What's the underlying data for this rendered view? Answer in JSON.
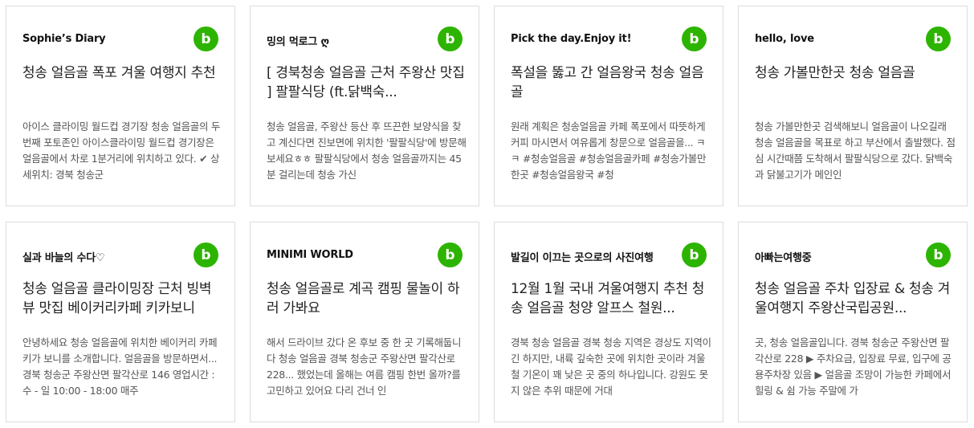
{
  "badge_letter": "b",
  "badge_color": "#2db400",
  "cards": [
    {
      "blog": "Sophie’s Diary",
      "title": "청송 얼음골 폭포 겨울 여행지 추천",
      "desc": "아이스 클라이밍 월드컵 경기장 청송 얼음골의 두 번째 포토존인 아이스클라이밍 월드컵 경기장은 얼음골에서 차로 1분거리에 위치하고 있다. ✔ 상세위치: 경북 청송군"
    },
    {
      "blog": "밍의 먹로그 ღ",
      "title": "[ 경북청송 얼음골 근처 주왕산 맛집 ] 팔팔식당 (ft.닭백숙...",
      "desc": "청송 얼음골, 주왕산 등산 후 뜨끈한 보양식을 찾고 계신다면 진보면에 위치한 '팔팔식당'에 방문해보세요ㅎㅎ 팔팔식당에서 청송 얼음골까지는 45분 걸리는데 청송 가신"
    },
    {
      "blog": "Pick the day.Enjoy it!",
      "title": "폭설을 뚫고 간 얼음왕국 청송 얼음골",
      "desc": "원래 계획은 청송얼음골 카페 폭포에서 따뜻하게 커피 마시면서 여유롭게 창문으로 얼음골을... ㅋㅋ #청송얼음골 #청송얼음골카페 #청송가볼만한곳 #청송얼음왕국 #청"
    },
    {
      "blog": "hello, love",
      "title": "청송 가볼만한곳 청송 얼음골",
      "desc": "청송 가볼만한곳 검색해보니 얼음골이 나오길래 청송 얼음골을 목표로 하고 부산에서 출발했다. 점심 시간때쯤 도착해서 팔팔식당으로 갔다. 닭백숙과 닭불고기가 메인인"
    },
    {
      "blog": "실과 바늘의 수다♡",
      "title": "청송 얼음골 클라이밍장 근처 빙벽뷰 맛집 베이커리카페 키카보니",
      "desc": "안녕하세요 청송 얼음골에 위치한 베이커리 카페 키가 보니를 소개합니다. 얼음골을 방문하면서... 경북 청송군 주왕산면 팔각산로 146 영업시간 : 수 - 일 10:00 - 18:00 매주"
    },
    {
      "blog": "MINIMI WORLD",
      "title": "청송 얼음골로 계곡 캠핑 물놀이 하러 가봐요",
      "desc": "해서 드라이브 갔다 온 후보 중 한 곳 기록해둡니다 청송 얼음골 경북 청송군 주왕산면 팔각산로 228... 했었는데 올해는 여름 캠핑 한번 올까?를 고민하고 있어요 다리 건너 인"
    },
    {
      "blog": "발길이 이끄는 곳으로의 사진여행",
      "title": "12월 1월 국내 겨울여행지 추천 청송 얼음골 청양 알프스 철원...",
      "desc": "경북 청송 얼음골 경북 청송 지역은 경상도 지역이긴 하지만, 내륙 깊숙한 곳에 위치한 곳이라 겨울철 기온이 꽤 낮은 곳 중의 하나입니다. 강원도 못지 않은 추위 때문에 거대"
    },
    {
      "blog": "아빠는여행중",
      "title": "청송 얼음골 주차 입장료 & 청송 겨울여행지 주왕산국립공원...",
      "desc": "곳, 청송 얼음골입니다. 경북 청송군 주왕산면 팔각산로 228 ▶ 주차요금, 입장료 무료, 입구에 공용주차장 있음 ▶ 얼음골 조망이 가능한 카페에서 힐링 & 쉼 가능 주말에 가"
    }
  ]
}
